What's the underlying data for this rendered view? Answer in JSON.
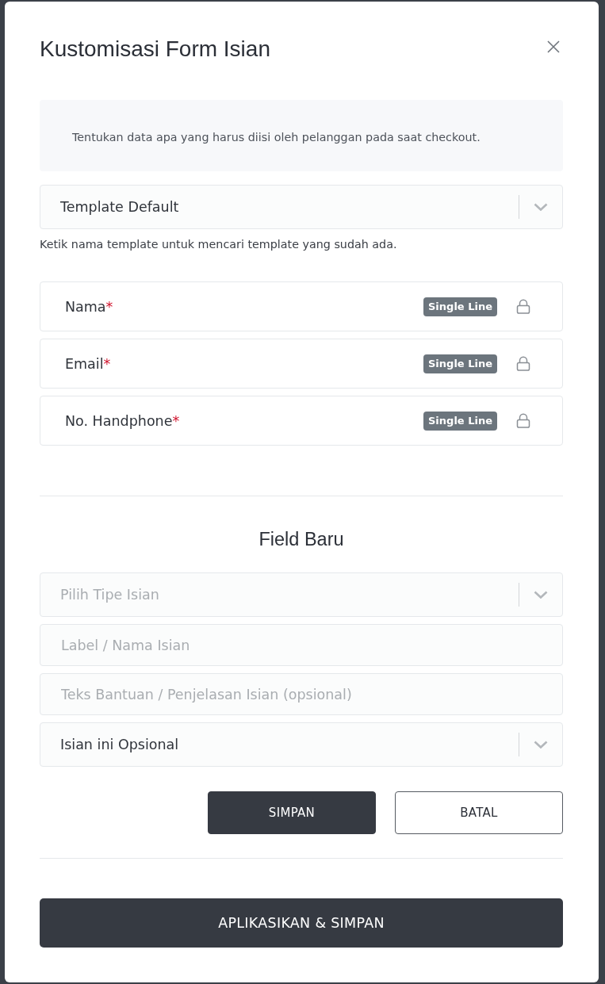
{
  "dialog": {
    "title": "Kustomisasi Form Isian"
  },
  "info_text": "Tentukan data apa yang harus diisi oleh pelanggan pada saat checkout.",
  "template_select": {
    "value": "Template Default",
    "help_text": "Ketik nama template untuk mencari template yang sudah ada."
  },
  "fields": [
    {
      "label": "Nama",
      "required_mark": "*",
      "type_badge": "Single Line",
      "locked": true
    },
    {
      "label": "Email",
      "required_mark": "*",
      "type_badge": "Single Line",
      "locked": true
    },
    {
      "label": "No. Handphone",
      "required_mark": "*",
      "type_badge": "Single Line",
      "locked": true
    }
  ],
  "new_field": {
    "title": "Field Baru",
    "inputs": [
      {
        "kind": "select",
        "placeholder": "Pilih Tipe Isian"
      },
      {
        "kind": "text",
        "placeholder": "Label / Nama Isian"
      },
      {
        "kind": "text",
        "placeholder": "Teks Bantuan / Penjelasan Isian (opsional)"
      },
      {
        "kind": "select",
        "value": "Isian ini Opsional"
      }
    ],
    "buttons": [
      {
        "label": "SIMPAN",
        "kind": "primary"
      },
      {
        "label": "BATAL",
        "kind": "outline"
      }
    ]
  },
  "apply_button": {
    "label": "APLIKASIKAN & SIMPAN"
  }
}
